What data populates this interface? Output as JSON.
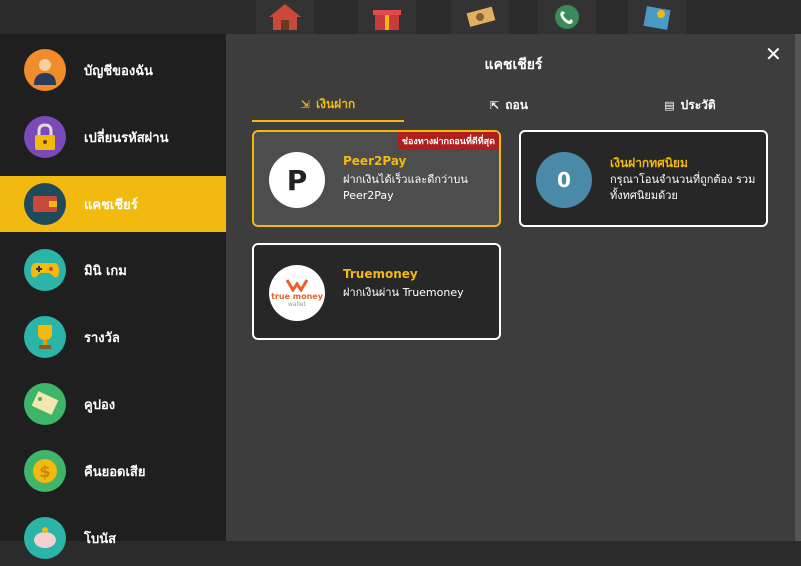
{
  "topbar": {
    "icons": [
      "house-icon",
      "gift-icon",
      "money-icon",
      "phone-icon",
      "wallet-icon"
    ]
  },
  "sidebar": {
    "items": [
      {
        "label": "บัญชีของฉัน",
        "icon": "user-avatar-icon",
        "color": "#f08c2a"
      },
      {
        "label": "เปลี่ยนรหัสผ่าน",
        "icon": "lock-icon",
        "color": "#7a4ab8"
      },
      {
        "label": "แคชเชียร์",
        "icon": "wallet-icon",
        "color": "#1e4a5c",
        "active": true
      },
      {
        "label": "มินิ เกม",
        "icon": "gamepad-icon",
        "color": "#2bb5a8"
      },
      {
        "label": "รางวัล",
        "icon": "trophy-icon",
        "color": "#2bb5a8"
      },
      {
        "label": "คูปอง",
        "icon": "coupon-icon",
        "color": "#3fb56a"
      },
      {
        "label": "คืนยอดเสีย",
        "icon": "coin-icon",
        "color": "#3fb56a"
      },
      {
        "label": "โบนัส",
        "icon": "piggy-bank-icon",
        "color": "#2bb5a8"
      }
    ]
  },
  "main": {
    "title": "แคชเชียร์",
    "tabs": [
      {
        "label": "เงินฝาก",
        "active": true
      },
      {
        "label": "ถอน",
        "active": false
      },
      {
        "label": "ประวัติ",
        "active": false
      }
    ],
    "cards": [
      {
        "name": "Peer2Pay",
        "desc": "ฝากเงินได้เร็วและดีกว่าบน Peer2Pay",
        "badge": "ช่องทางฝากถอนที่ดีที่สุด",
        "logo": "P"
      },
      {
        "name": "เงินฝากทศนิยม",
        "desc": "กรุณาโอนจำนวนที่ถูกต้อง รวมทั้งทศนิยมด้วย",
        "logo": "0"
      },
      {
        "name": "Truemoney",
        "desc": "ฝากเงินผ่าน Truemoney",
        "logo_text1": "true money",
        "logo_text2": "wallet"
      }
    ]
  }
}
